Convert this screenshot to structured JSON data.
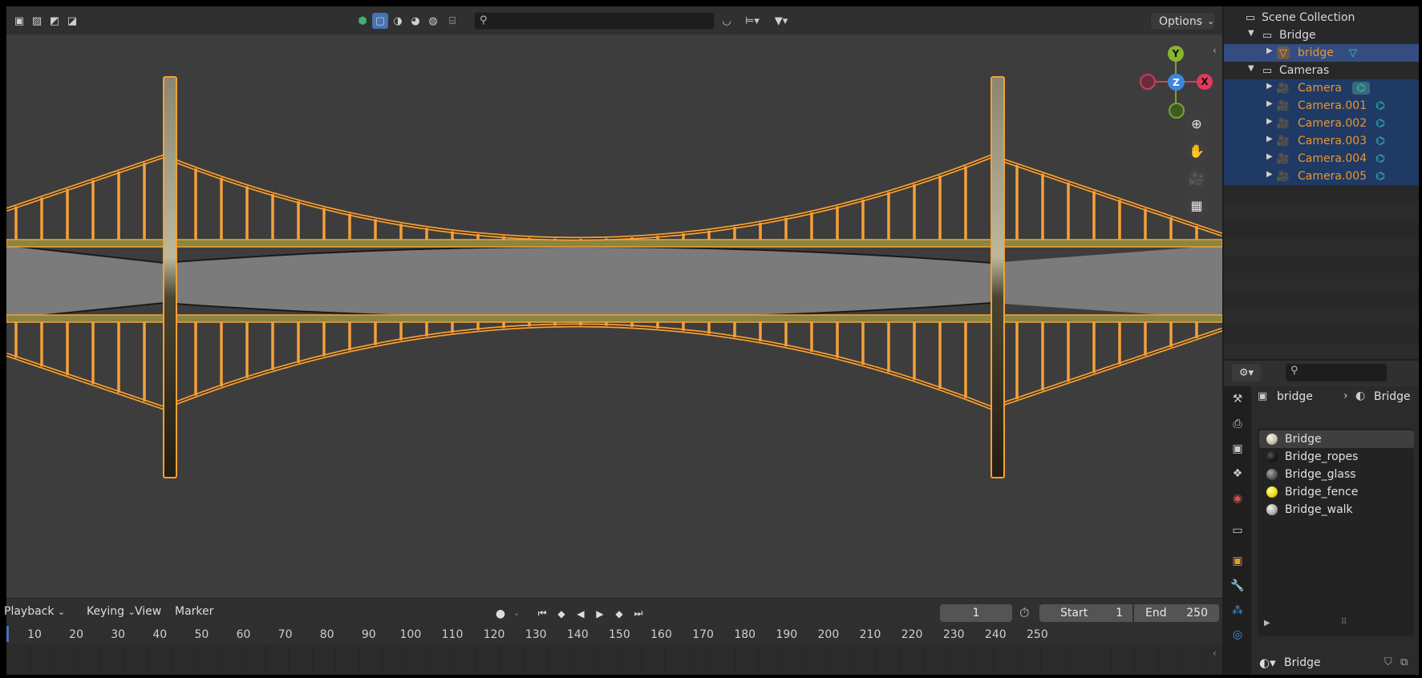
{
  "viewport": {
    "options_label": "Options",
    "search_placeholder": "",
    "gizmo": {
      "y": "Y",
      "z": "Z",
      "x": "X"
    }
  },
  "timeline": {
    "menus": [
      "Playback",
      "Keying",
      "View",
      "Marker"
    ],
    "current_frame": "1",
    "start_label": "Start",
    "start_value": "1",
    "end_label": "End",
    "end_value": "250",
    "ticks": [
      "10",
      "20",
      "30",
      "40",
      "50",
      "60",
      "70",
      "80",
      "90",
      "100",
      "110",
      "120",
      "130",
      "140",
      "150",
      "160",
      "170",
      "180",
      "190",
      "200",
      "210",
      "220",
      "230",
      "240",
      "250"
    ]
  },
  "outliner": {
    "root": "Scene Collection",
    "collections": [
      {
        "name": "Bridge",
        "children": [
          {
            "name": "bridge"
          }
        ]
      },
      {
        "name": "Cameras",
        "children": [
          {
            "name": "Camera"
          },
          {
            "name": "Camera.001"
          },
          {
            "name": "Camera.002"
          },
          {
            "name": "Camera.003"
          },
          {
            "name": "Camera.004"
          },
          {
            "name": "Camera.005"
          }
        ]
      }
    ]
  },
  "properties": {
    "breadcrumb_object": "bridge",
    "breadcrumb_material": "Bridge",
    "materials": [
      {
        "name": "Bridge",
        "color": "#c8c6b0"
      },
      {
        "name": "Bridge_ropes",
        "color": "#141414"
      },
      {
        "name": "Bridge_glass",
        "color": "#5a5a5a"
      },
      {
        "name": "Bridge_fence",
        "color": "#f0e010"
      },
      {
        "name": "Bridge_walk",
        "color": "#b0b0b0"
      }
    ],
    "active_material": "Bridge"
  },
  "colors": {
    "selection_outline": "#f5a03a",
    "viewport_bg": "#3d3d3d",
    "outliner_selected": "#334d80"
  }
}
